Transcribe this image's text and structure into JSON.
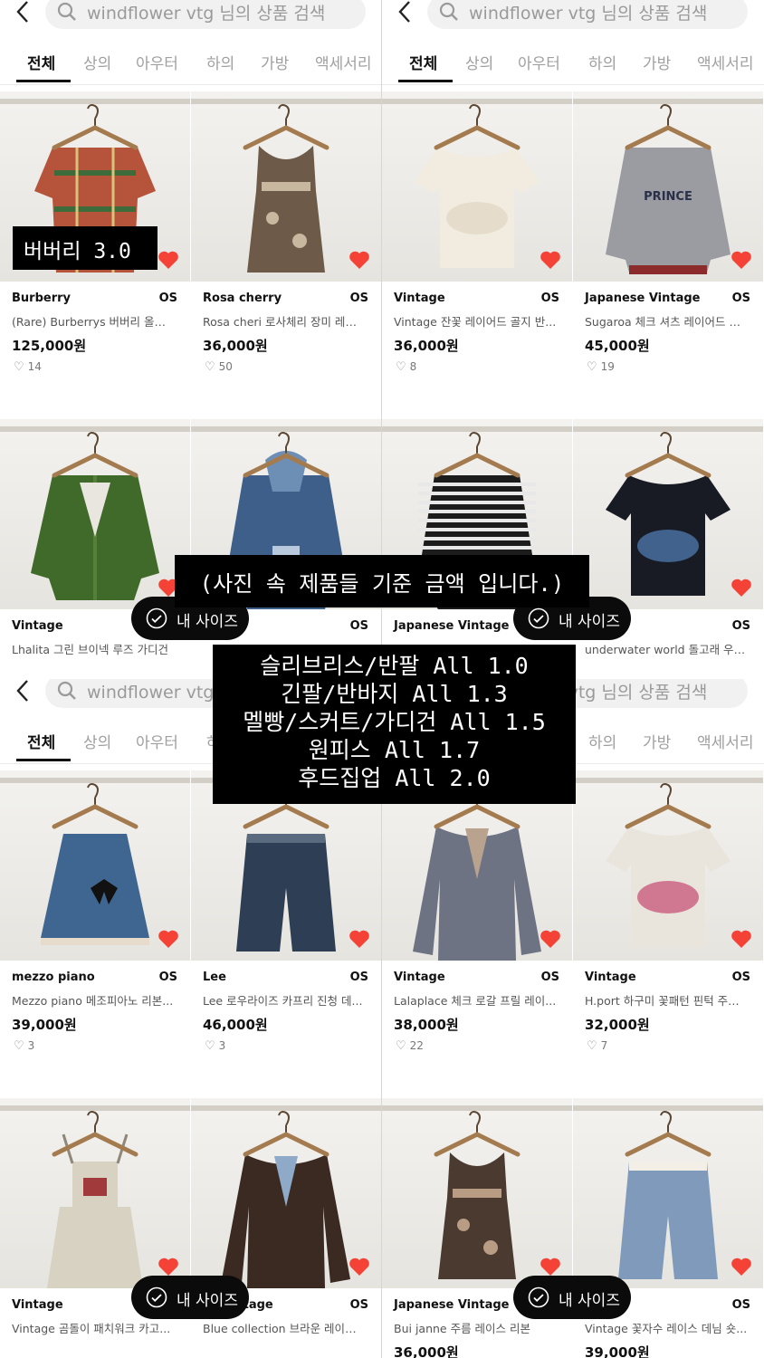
{
  "search": {
    "placeholder": "windflower vtg 님의 상품 검색"
  },
  "tabs": [
    "전체",
    "상의",
    "아우터",
    "하의",
    "가방",
    "액세서리"
  ],
  "colors": {
    "heart": "#f44336",
    "overlay_bg": "#000000",
    "pill_bg": "#0b0b0b",
    "text_gray": "#555555"
  },
  "icons": {
    "back": "chevron-left-icon",
    "search": "search-icon",
    "like": "heart-icon",
    "check": "check-circle-icon"
  },
  "quads": [
    {
      "cards": [
        {
          "brand": "Burberry",
          "size": "OS",
          "title": "(Rare) Burberrys 버버리 올드...",
          "price": "125,000원",
          "likes": "14",
          "garment": "plaid-jacket"
        },
        {
          "brand": "Rosa cherry",
          "size": "OS",
          "title": "Rosa cheri 로사체리 장미 레이...",
          "price": "36,000원",
          "likes": "50",
          "garment": "floral-top"
        },
        {
          "brand": "Vintage",
          "size": "",
          "title": "Lhalita 그린 브이넥 루즈 가디건",
          "price": "",
          "likes": "",
          "garment": "green-cardigan"
        },
        {
          "brand": "",
          "size": "OS",
          "title": "",
          "price": "",
          "likes": "",
          "garment": "denim-hoodie"
        }
      ]
    },
    {
      "cards": [
        {
          "brand": "Vintage",
          "size": "OS",
          "title": "Vintage 잔꽃 레이어드 골지 반...",
          "price": "36,000원",
          "likes": "8",
          "garment": "cream-tee"
        },
        {
          "brand": "Japanese Vintage",
          "size": "OS",
          "title": "Sugaroa 체크 셔츠 레이어드 맨...",
          "price": "45,000원",
          "likes": "19",
          "garment": "gray-sweatshirt"
        },
        {
          "brand": "Japanese Vintage",
          "size": "",
          "title": "",
          "price": "",
          "likes": "",
          "garment": "striped-knit"
        },
        {
          "brand": "",
          "size": "OS",
          "title": "underwater world 돌고래 우주...",
          "price": "",
          "likes": "",
          "garment": "dolphin-tee"
        }
      ]
    },
    {
      "cards": [
        {
          "brand": "mezzo piano",
          "size": "OS",
          "title": "Mezzo piano 메조피아노 리본...",
          "price": "39,000원",
          "likes": "3",
          "garment": "denim-skirt"
        },
        {
          "brand": "Lee",
          "size": "OS",
          "title": "Lee 로우라이즈 카프리 진청 데...",
          "price": "46,000원",
          "likes": "3",
          "garment": "denim-shorts"
        },
        {
          "brand": "Vintage",
          "size": "",
          "title": "Vintage 곰돌이 패치워크 카고...",
          "price": "",
          "likes": "",
          "garment": "overalls"
        },
        {
          "brand": "se Vintage",
          "size": "OS",
          "title": "Blue collection 브라운 레이스...",
          "price": "",
          "likes": "",
          "garment": "brown-blouse"
        }
      ]
    },
    {
      "cards": [
        {
          "brand": "Vintage",
          "size": "OS",
          "title": "Lalaplace 체크 로갈 프릴 레이...",
          "price": "38,000원",
          "likes": "22",
          "garment": "gray-blouse"
        },
        {
          "brand": "Vintage",
          "size": "OS",
          "title": "H.port 하구미 꽃패턴 핀턱 주름...",
          "price": "32,000원",
          "likes": "7",
          "garment": "floral-tee"
        },
        {
          "brand": "Japanese Vintage",
          "size": "",
          "title": "Bui janne 주름 레이스 리본",
          "price": "36,000원",
          "likes": "",
          "garment": "brown-lace-top"
        },
        {
          "brand": "",
          "size": "OS",
          "title": "Vintage 꽃자수 레이스 데님 숏...",
          "price": "39,000원",
          "likes": "",
          "garment": "lace-shorts"
        }
      ]
    }
  ],
  "pill_label": "내 사이즈",
  "overlays": {
    "burberry_tag": "버버리 3.0",
    "note": "(사진 속 제품들 기준 금액 입니다.)",
    "price_rules": [
      "슬리브리스/반팔 All 1.0",
      "긴팔/반바지 All 1.3",
      "멜빵/스커트/가디건 All 1.5",
      "원피스 All 1.7",
      "후드집업 All 2.0"
    ]
  }
}
